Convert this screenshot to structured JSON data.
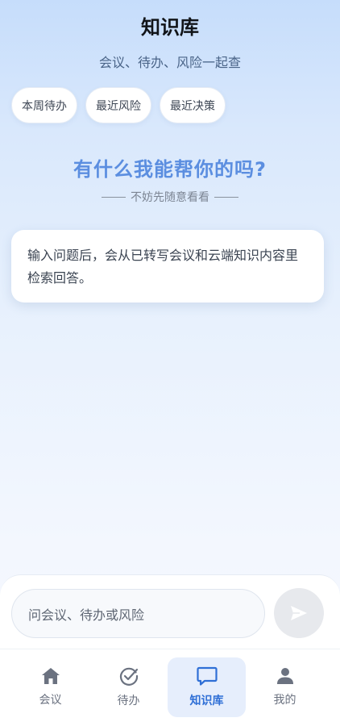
{
  "header": {
    "title": "知识库",
    "subtitle": "会议、待办、风险一起查"
  },
  "chips": [
    {
      "label": "本周待办"
    },
    {
      "label": "最近风险"
    },
    {
      "label": "最近决策"
    }
  ],
  "hero": {
    "title": "有什么我能帮你的吗?",
    "subtitle": "不妨先随意看看"
  },
  "info_card": {
    "text": "输入问题后，会从已转写会议和云端知识内容里检索回答。"
  },
  "composer": {
    "placeholder": "问会议、待办或风险",
    "send_icon": "send-icon"
  },
  "tabbar": {
    "items": [
      {
        "label": "会议",
        "icon": "home-icon",
        "active": false
      },
      {
        "label": "待办",
        "icon": "check-circle-icon",
        "active": false
      },
      {
        "label": "知识库",
        "icon": "chat-icon",
        "active": true
      },
      {
        "label": "我的",
        "icon": "user-icon",
        "active": false
      }
    ]
  },
  "colors": {
    "accent": "#2f6fd6",
    "hero": "#5b8ee0",
    "tab_active_bg": "#e6eefc"
  }
}
